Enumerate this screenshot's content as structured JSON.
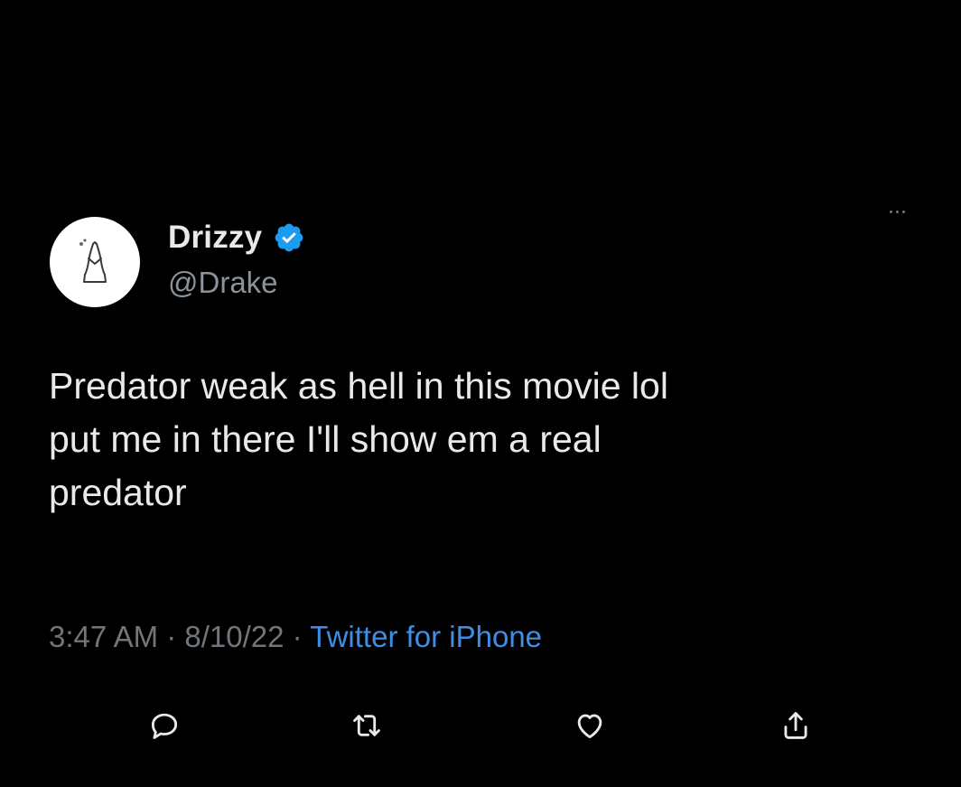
{
  "tweet": {
    "author": {
      "display_name": "Drizzy",
      "handle": "@Drake",
      "verified": true,
      "avatar_icon": "praying-hands-icon"
    },
    "text_lines": [
      "Predator weak as hell in this movie lol",
      "put me in there I'll show em a real",
      "predator"
    ],
    "meta": {
      "time": "3:47 AM",
      "separator": " · ",
      "date": "8/10/22",
      "source": "Twitter for iPhone"
    },
    "actions": [
      {
        "name": "reply",
        "icon": "reply-icon"
      },
      {
        "name": "retweet",
        "icon": "retweet-icon"
      },
      {
        "name": "like",
        "icon": "heart-icon"
      },
      {
        "name": "share",
        "icon": "share-icon"
      }
    ]
  },
  "colors": {
    "background": "#000000",
    "primary_text": "#e7e9ea",
    "secondary_text": "#71767b",
    "link": "#3f8ee6",
    "verified": "#1d9bf0"
  }
}
